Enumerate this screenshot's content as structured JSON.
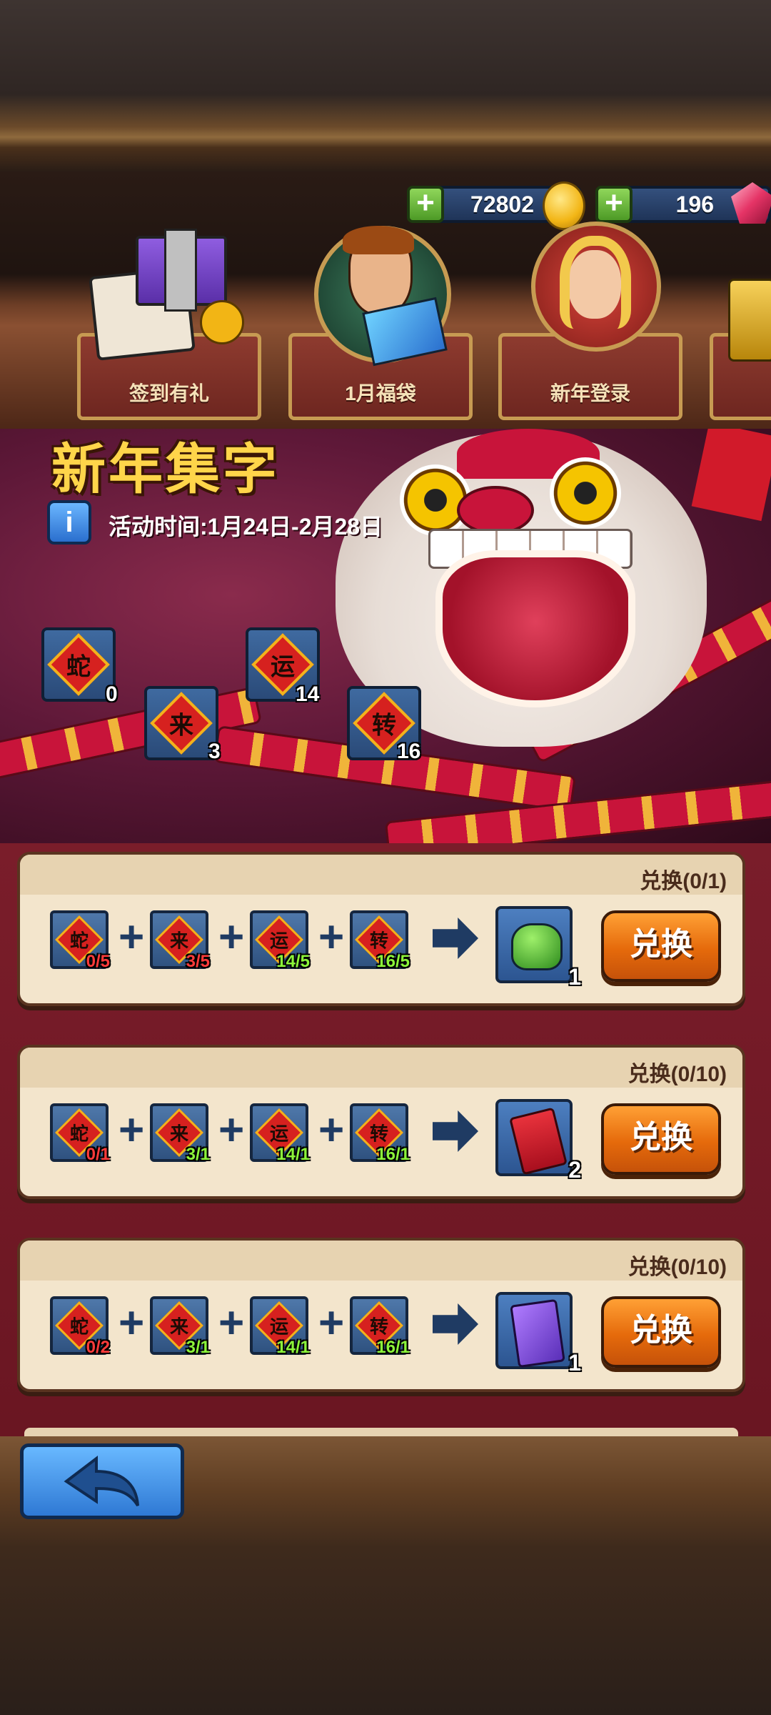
{
  "currency": {
    "gold": "72802",
    "gems": "196",
    "plus_label": "+"
  },
  "tabs": [
    {
      "label": "签到有礼",
      "icon": "gift-calendar-icon"
    },
    {
      "label": "1月福袋",
      "icon": "hero-portrait-icon"
    },
    {
      "label": "新年登录",
      "icon": "lion-girl-portrait-icon"
    },
    {
      "label": "",
      "icon": "treasure-icon"
    }
  ],
  "banner": {
    "title": "新年集字",
    "info_label": "i",
    "event_time": "活动时间:1月24日-2月28日"
  },
  "collected": [
    {
      "char": "蛇",
      "count": "0"
    },
    {
      "char": "来",
      "count": "3"
    },
    {
      "char": "运",
      "count": "14"
    },
    {
      "char": "转",
      "count": "16"
    }
  ],
  "exchanges": [
    {
      "limit": "兑换(0/1)",
      "requirements": [
        {
          "char": "蛇",
          "progress": "0/5",
          "met": false
        },
        {
          "char": "来",
          "progress": "3/5",
          "met": false
        },
        {
          "char": "运",
          "progress": "14/5",
          "met": true
        },
        {
          "char": "转",
          "progress": "16/5",
          "met": true
        }
      ],
      "reward": {
        "icon": "green-mask-icon",
        "count": "1"
      },
      "button": "兑换"
    },
    {
      "limit": "兑换(0/10)",
      "requirements": [
        {
          "char": "蛇",
          "progress": "0/1",
          "met": false
        },
        {
          "char": "来",
          "progress": "3/1",
          "met": true
        },
        {
          "char": "运",
          "progress": "14/1",
          "met": true
        },
        {
          "char": "转",
          "progress": "16/1",
          "met": true
        }
      ],
      "reward": {
        "icon": "red-envelope-icon",
        "count": "2"
      },
      "button": "兑换"
    },
    {
      "limit": "兑换(0/10)",
      "requirements": [
        {
          "char": "蛇",
          "progress": "0/2",
          "met": false
        },
        {
          "char": "来",
          "progress": "3/1",
          "met": true
        },
        {
          "char": "运",
          "progress": "14/1",
          "met": true
        },
        {
          "char": "转",
          "progress": "16/1",
          "met": true
        }
      ],
      "reward": {
        "icon": "card-pack-icon",
        "count": "1"
      },
      "button": "兑换"
    }
  ],
  "symbols": {
    "plus": "+"
  },
  "colors": {
    "met": "#8cf53a",
    "unmet": "#ff3b3b",
    "button_orange": "#e56a0b",
    "panel": "#f3e5cc"
  }
}
